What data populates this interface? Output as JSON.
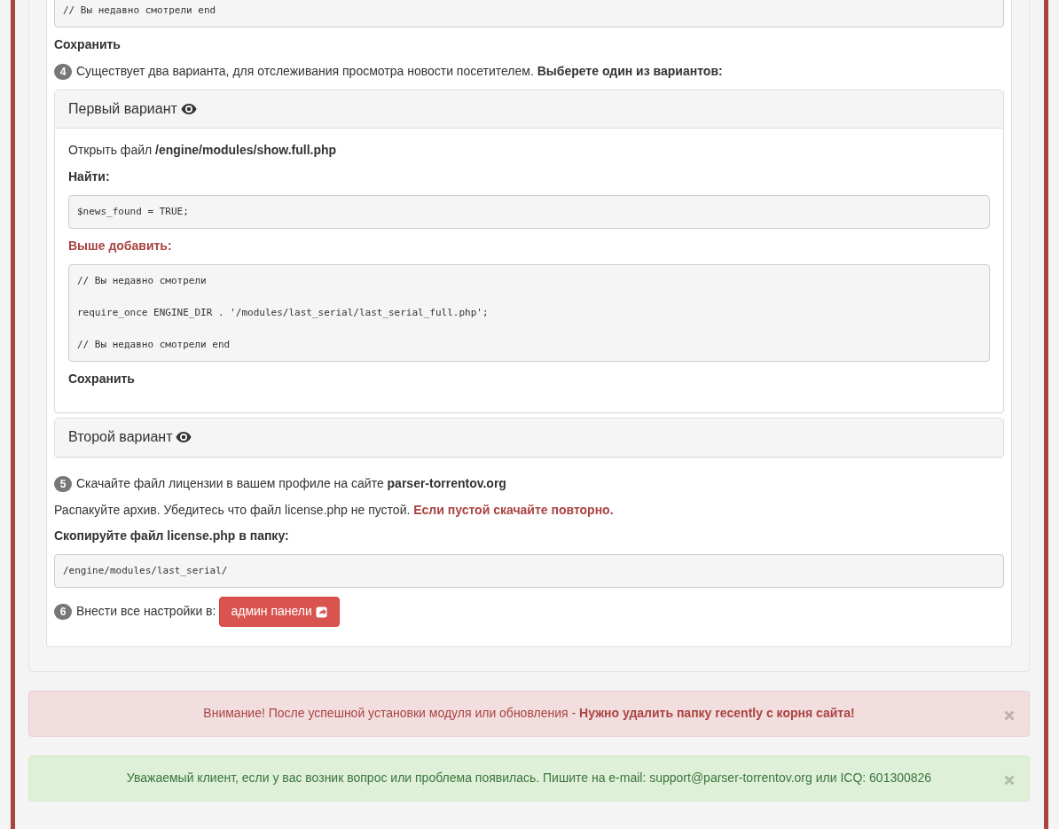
{
  "blocks": [
    {
      "kind": "code",
      "lines": [
        "// Вы недавно смотрели end"
      ]
    },
    {
      "kind": "heading",
      "text": "Сохранить"
    },
    {
      "kind": "step",
      "number": "4",
      "text": "Существует два варианта, для отслеживания просмотра новости посетителем. **Выберете один из вариантов:**"
    },
    {
      "kind": "accordion",
      "panels": [
        {
          "title": "Первый вариант",
          "expanded": true,
          "blocks": [
            {
              "kind": "text",
              "text": "Открыть файл **/engine/modules/show.full.php**"
            },
            {
              "kind": "heading",
              "text": "Найти:"
            },
            {
              "kind": "code",
              "lines": [
                "$news_found = TRUE;"
              ]
            },
            {
              "kind": "warning_heading",
              "text": "Выше добавить:"
            },
            {
              "kind": "code",
              "lines": [
                "// Вы недавно смотрели",
                "require_once ENGINE_DIR . '/modules/last_serial/last_serial_full.php';",
                "// Вы недавно смотрели end"
              ]
            },
            {
              "kind": "heading",
              "text": "Сохранить"
            }
          ]
        },
        {
          "title": "Второй вариант",
          "expanded": false
        }
      ]
    },
    {
      "kind": "step",
      "number": "5",
      "text": "Скачайте файл лицензии в вашем профиле на сайте **parser-torrentov.org**"
    },
    {
      "kind": "text",
      "text": "Распакуйте архив. Убедитесь что файл license.php не пустой.",
      "warning": "Если пустой скачайте повторно."
    },
    {
      "kind": "heading",
      "text": "Скопируйте файл license.php в папку:"
    },
    {
      "kind": "code",
      "lines": [
        "/engine/modules/last_serial/"
      ]
    },
    {
      "kind": "step_button",
      "number": "6",
      "text": "Внести все настройки в:",
      "button": "админ панели"
    }
  ],
  "alerts": [
    {
      "kind": "danger",
      "text": "Внимание! После успешной установки модуля или обновления - **Нужно удалить папку recently с корня сайта!**"
    },
    {
      "kind": "success",
      "text": "Уважаемый клиент, если у вас возник вопрос или проблема появилась. Пишите на e-mail: support@parser-torrentov.org или ICQ: 601300826"
    }
  ]
}
